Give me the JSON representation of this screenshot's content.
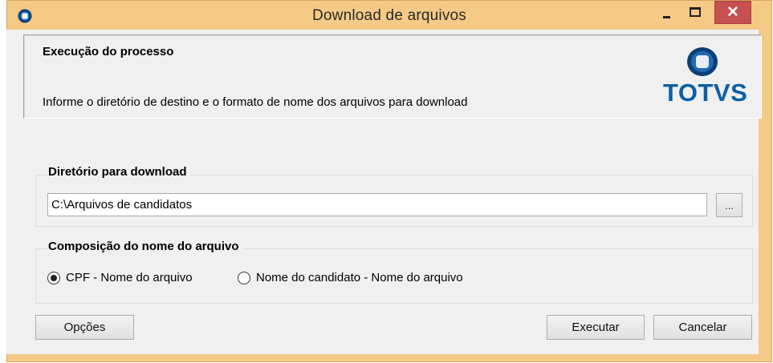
{
  "window": {
    "title": "Download de arquivos",
    "close_glyph": "✕"
  },
  "header": {
    "title": "Execução do processo",
    "description": "Informe o diretório de destino e o formato de nome dos arquivos para download",
    "logo_text": "TOTVS"
  },
  "directory": {
    "label": "Diretório para download",
    "path": "C:\\Arquivos de candidatos",
    "browse_label": "..."
  },
  "filename": {
    "label": "Composição do nome do arquivo",
    "options": [
      {
        "label": "CPF - Nome do arquivo",
        "selected": true
      },
      {
        "label": "Nome do candidato - Nome do arquivo",
        "selected": false
      }
    ]
  },
  "buttons": {
    "options": "Opções",
    "execute": "Executar",
    "cancel": "Cancelar"
  },
  "colors": {
    "titlebar": "#f5ca87",
    "close": "#c75050",
    "brand": "#0b5fa6"
  },
  "icons": {
    "app": "totvs-logo-icon",
    "minimize": "minimize-icon",
    "maximize": "maximize-icon",
    "close": "close-icon"
  }
}
